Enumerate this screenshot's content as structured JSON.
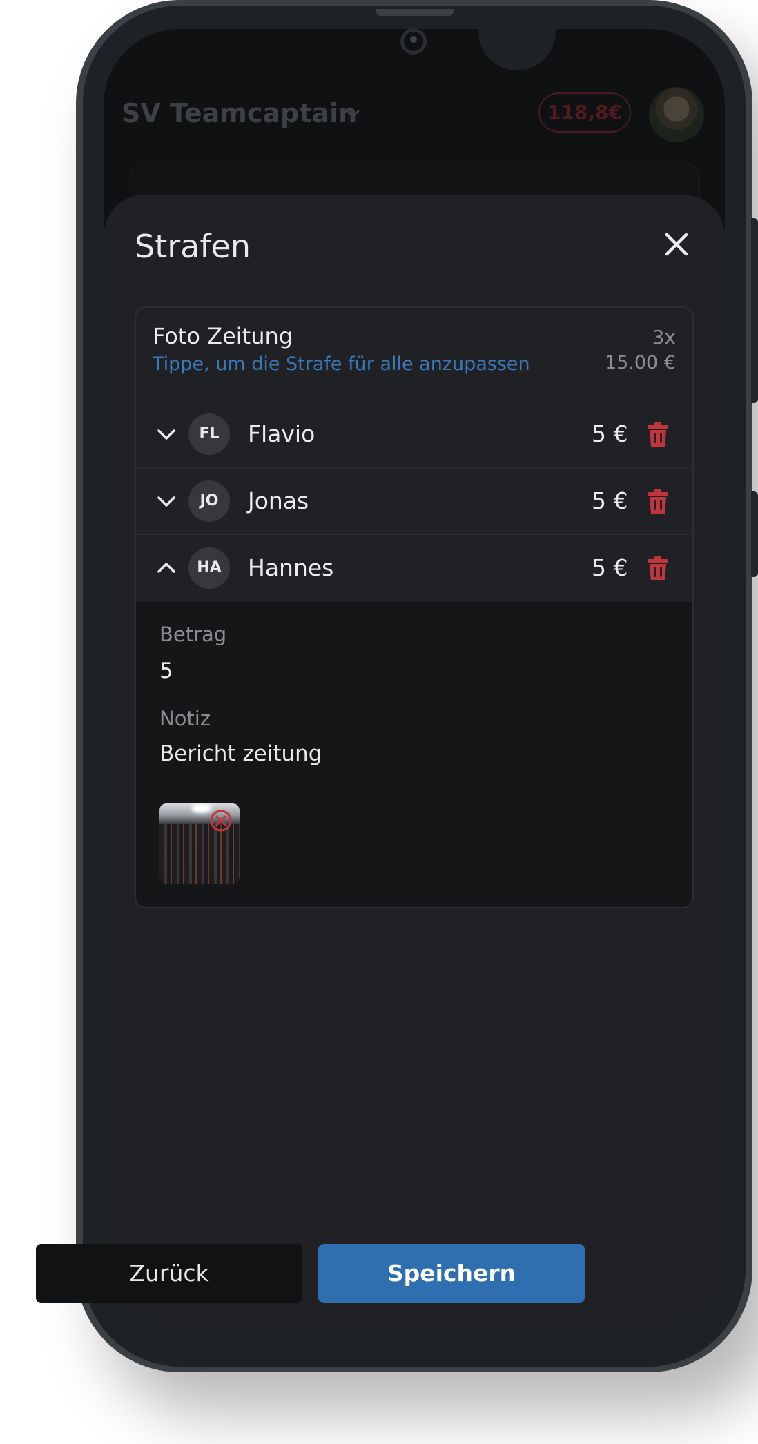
{
  "app": {
    "team_name": "SV Teamcaptain",
    "balance": "118,8€"
  },
  "sheet": {
    "title": "Strafen"
  },
  "penalty": {
    "name": "Foto Zeitung",
    "hint": "Tippe, um die Strafe für alle anzupassen",
    "count": "3x",
    "total": "15.00 €"
  },
  "rows": [
    {
      "initials": "FL",
      "name": "Flavio",
      "amount": "5 €",
      "expanded": false
    },
    {
      "initials": "JO",
      "name": "Jonas",
      "amount": "5 €",
      "expanded": false
    },
    {
      "initials": "HA",
      "name": "Hannes",
      "amount": "5 €",
      "expanded": true
    }
  ],
  "details": {
    "amount_label": "Betrag",
    "amount_value": "5",
    "note_label": "Notiz",
    "note_value": "Bericht zeitung"
  },
  "buttons": {
    "back": "Zurück",
    "save": "Speichern"
  },
  "colors": {
    "accent": "#2f6fb0",
    "danger": "#c1363d",
    "sheet_bg": "#202125"
  }
}
